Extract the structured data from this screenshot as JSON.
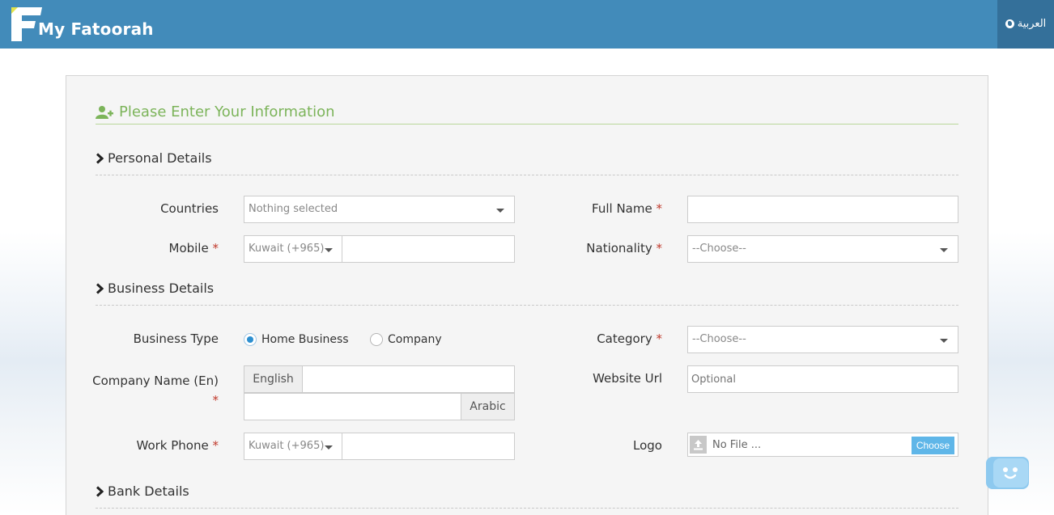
{
  "header": {
    "brand": "My Fatoorah",
    "language_label": "العربية"
  },
  "form": {
    "title": "Please Enter Your Information",
    "sections": {
      "personal": "Personal Details",
      "business": "Business Details",
      "bank": "Bank Details"
    },
    "countries": {
      "label": "Countries",
      "value": "Nothing selected"
    },
    "full_name": {
      "label": "Full Name",
      "value": ""
    },
    "mobile": {
      "label": "Mobile",
      "country_code": "Kuwait (+965)",
      "value": ""
    },
    "nationality": {
      "label": "Nationality",
      "value": "--Choose--"
    },
    "business_type": {
      "label": "Business Type",
      "options": [
        "Home Business",
        "Company"
      ],
      "selected": "Home Business"
    },
    "category": {
      "label": "Category",
      "value": "--Choose--"
    },
    "company_name": {
      "label": "Company Name (En)",
      "english_addon": "English",
      "arabic_addon": "Arabic",
      "english_value": "",
      "arabic_value": ""
    },
    "website": {
      "label": "Website Url",
      "placeholder": "Optional"
    },
    "work_phone": {
      "label": "Work Phone",
      "country_code": "Kuwait (+965)",
      "value": ""
    },
    "logo": {
      "label": "Logo",
      "file_text": "No File ...",
      "button": "Choose"
    },
    "required_marker": "*"
  },
  "colors": {
    "topbar": "#428bba",
    "lang_bg": "#34709a",
    "title_green": "#7cb45a",
    "required_red": "#c0392b",
    "choose_blue": "#5fb6e8"
  }
}
